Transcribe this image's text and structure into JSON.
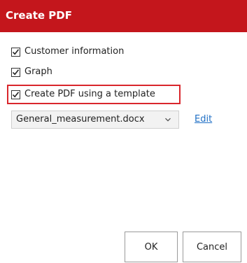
{
  "dialog": {
    "title": "Create PDF"
  },
  "options": [
    {
      "label": "Customer information",
      "checked": true
    },
    {
      "label": "Graph",
      "checked": true
    },
    {
      "label": "Create PDF using a template",
      "checked": true
    }
  ],
  "template": {
    "selected": "General_measurement.docx",
    "edit_label": "Edit"
  },
  "buttons": {
    "ok_label": "OK",
    "cancel_label": "Cancel"
  },
  "colors": {
    "titlebar": "#c4161c",
    "highlight_border": "#d9262c",
    "link": "#1f6fc5"
  }
}
